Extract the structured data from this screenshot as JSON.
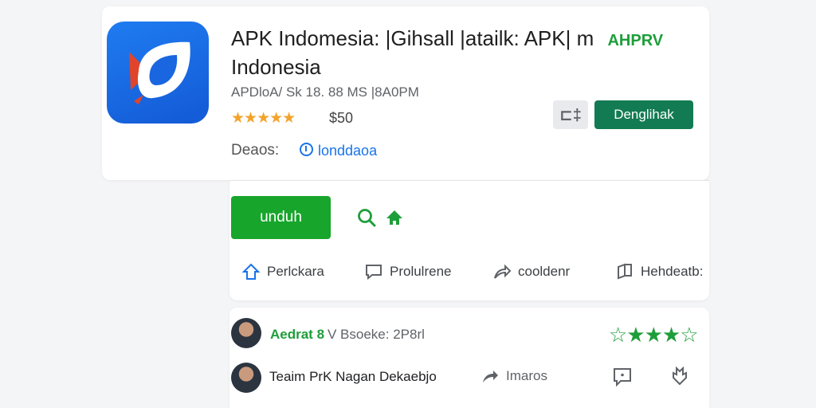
{
  "app": {
    "title": "APK Indomesia: |Gihsall |atailk: APK| m",
    "title_line2": "Indonesia",
    "badge": "AHPRV",
    "meta": "APDloA/ Sk 18. 88 MS |8A0PM",
    "rating_stars": "★★★★★",
    "rating_value": 4.5,
    "price": "$50",
    "devs_label": "Deaos:",
    "devs_link": "londdaoa"
  },
  "buttons": {
    "small_icon": "⊏‡",
    "primary": "Denglihak",
    "unduh": "unduh"
  },
  "actions": [
    {
      "label": "Perlckara",
      "icon": "home-outline-icon"
    },
    {
      "label": "Prolulrene",
      "icon": "chat-icon"
    },
    {
      "label": "cooldenr",
      "icon": "share-icon"
    },
    {
      "label": "Hehdeatb:",
      "icon": "book-icon"
    }
  ],
  "reviews": [
    {
      "name": "Aedrat  8",
      "meta": "V  Bsoeke:  2P8rl",
      "stars": "☆★★★☆"
    },
    {
      "name": "Teaim PrK Nagan Dekaebjo",
      "action_label": "Imaros"
    }
  ],
  "colors": {
    "accent_blue": "#1a73e8",
    "green_primary": "#137b53",
    "green_download": "#17a52b",
    "star_gold": "#f3a32b",
    "review_green": "#1e9e3a"
  }
}
